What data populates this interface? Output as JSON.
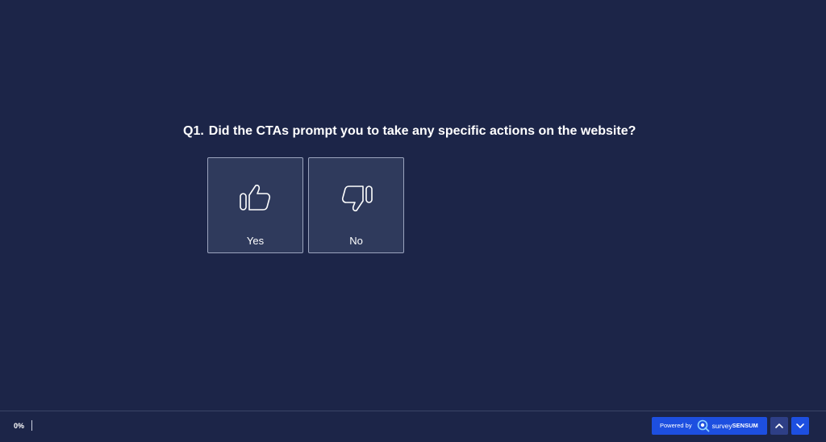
{
  "question": {
    "number": "Q1.",
    "text": "Did the CTAs prompt you to take any specific actions on the website?"
  },
  "options": [
    {
      "label": "Yes",
      "icon": "thumbs-up-icon"
    },
    {
      "label": "No",
      "icon": "thumbs-down-icon"
    }
  ],
  "footer": {
    "progress_text": "0%",
    "progress_value": 0,
    "powered_by": "Powered by",
    "brand_part1": "survey",
    "brand_part2": "SENSUM",
    "up_icon": "chevron-up-icon",
    "down_icon": "chevron-down-icon"
  },
  "colors": {
    "background": "#1c2548",
    "option_bg": "#2f3a5c",
    "accent": "#1d4fe0"
  }
}
